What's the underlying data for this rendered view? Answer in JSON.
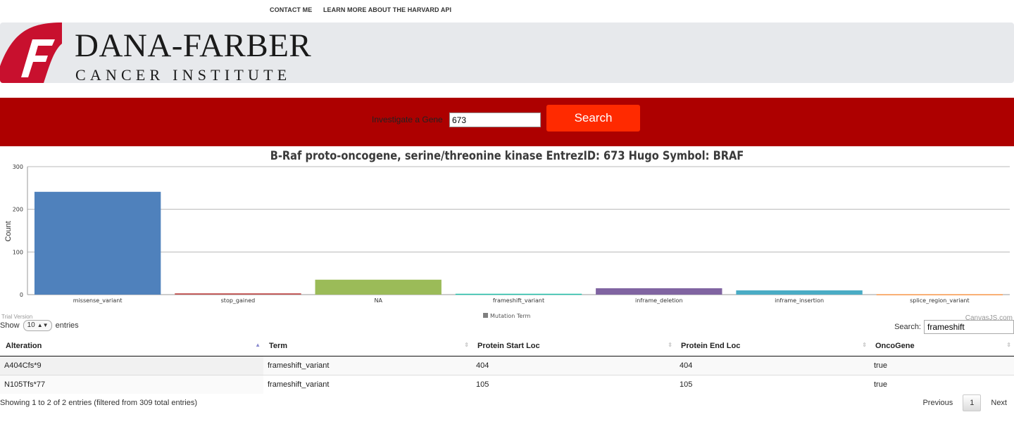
{
  "nav": {
    "contact": "CONTACT ME",
    "learn_more": "LEARN MORE ABOUT THE HARVARD API"
  },
  "brand": {
    "line1": "DANA-FARBER",
    "line2": "CANCER INSTITUTE",
    "accent": "#c8102e"
  },
  "gene_search": {
    "label": "Investigate a Gene",
    "value": "673",
    "button": "Search"
  },
  "chart_data": {
    "type": "bar",
    "title": "B-Raf proto-oncogene, serine/threonine kinase EntrezID: 673 Hugo Symbol: BRAF",
    "ylabel": "Count",
    "xlabel": "",
    "ylim": [
      0,
      300
    ],
    "yticks": [
      "0",
      "100",
      "200",
      "300"
    ],
    "categories": [
      "missense_variant",
      "stop_gained",
      "NA",
      "frameshift_variant",
      "inframe_deletion",
      "inframe_insertion",
      "splice_region_variant"
    ],
    "values": [
      241,
      3,
      35,
      2,
      15,
      10,
      1
    ],
    "colors": [
      "#4f81bc",
      "#c0504e",
      "#9bbb58",
      "#23bfaa",
      "#8064a1",
      "#4aacc5",
      "#f79647"
    ],
    "legend": "Mutation Term",
    "legend_color": "#808080",
    "grid": true
  },
  "watermarks": {
    "trial": "Trial Version",
    "credit": "CanvasJS.com"
  },
  "table": {
    "show_prefix": "Show",
    "page_length": "10",
    "show_suffix": "entries",
    "search_label": "Search:",
    "search_value": "frameshift",
    "columns": [
      "Alteration",
      "Term",
      "Protein Start Loc",
      "Protein End Loc",
      "OncoGene"
    ],
    "rows": [
      [
        "A404Cfs*9",
        "frameshift_variant",
        "404",
        "404",
        "true"
      ],
      [
        "N105Tfs*77",
        "frameshift_variant",
        "105",
        "105",
        "true"
      ]
    ],
    "info": "Showing 1 to 2 of 2 entries (filtered from 309 total entries)",
    "pagination": {
      "previous": "Previous",
      "page": "1",
      "next": "Next"
    }
  }
}
